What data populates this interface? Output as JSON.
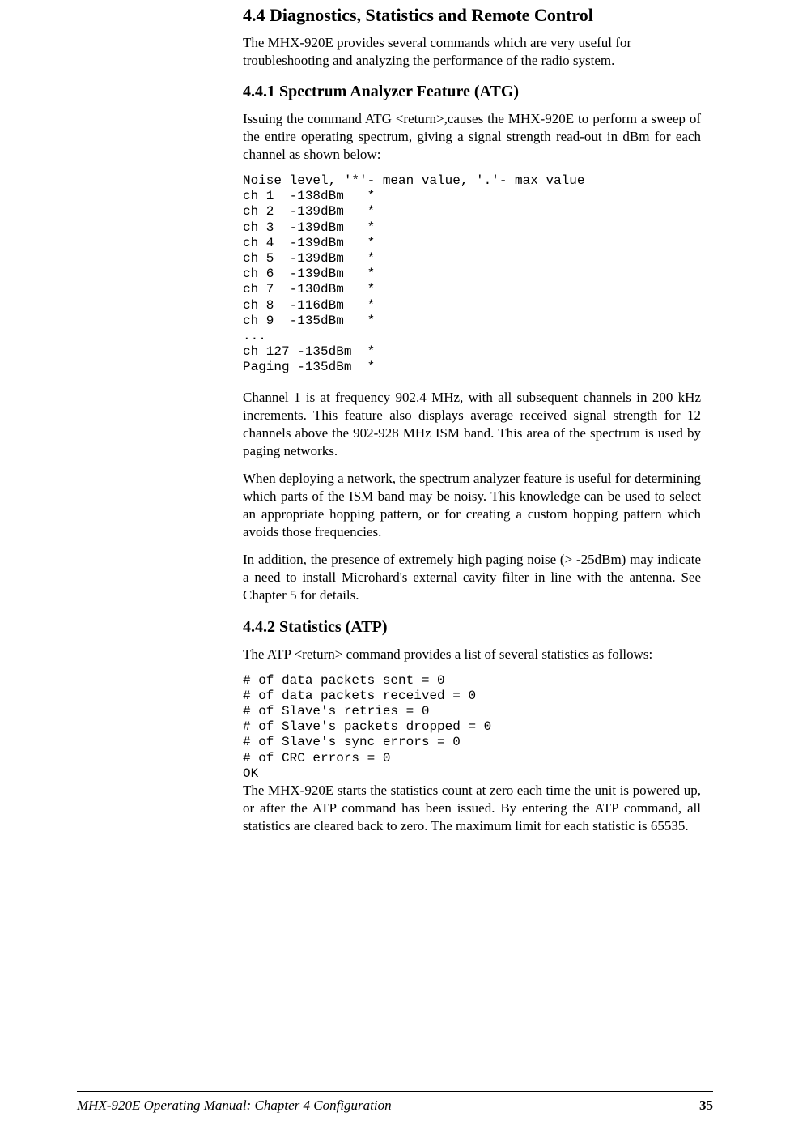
{
  "section": {
    "heading": "4.4 Diagnostics, Statistics and Remote Control",
    "intro": "The MHX-920E provides several commands which are very useful for troubleshooting and analyzing the performance of the radio system."
  },
  "subsection1": {
    "heading": "4.4.1  Spectrum Analyzer Feature (ATG)",
    "para1": "Issuing the command ATG <return>,causes the MHX-920E to perform a sweep of the entire operating spectrum, giving a signal strength read-out in dBm for each channel as shown below:",
    "mono": "Noise level, '*'- mean value, '.'- max value\nch 1  -138dBm   *\nch 2  -139dBm   *\nch 3  -139dBm   *\nch 4  -139dBm   *\nch 5  -139dBm   *\nch 6  -139dBm   *\nch 7  -130dBm   *\nch 8  -116dBm   *\nch 9  -135dBm   *\n...\nch 127 -135dBm  *\nPaging -135dBm  *",
    "para2": "Channel 1 is at frequency 902.4 MHz, with all subsequent channels in 200 kHz increments.  This feature also displays average received signal strength for  12 channels above the 902-928 MHz ISM band.  This area of the spectrum is used by paging networks.",
    "para3": "When deploying a network, the spectrum analyzer feature is useful for determining which parts of the ISM band may be noisy.  This knowledge can be used to select an appropriate hopping pattern, or for creating a custom hopping pattern which avoids those frequencies.",
    "para4": "In addition, the presence of extremely high paging noise (> -25dBm) may indicate a need to install Microhard's external cavity filter in line with the antenna.  See Chapter 5 for details."
  },
  "subsection2": {
    "heading": "4.4.2  Statistics (ATP)",
    "para1": "The ATP <return> command provides a list of several statistics as follows:",
    "mono": "# of data packets sent = 0\n# of data packets received = 0\n# of Slave's retries = 0\n# of Slave's packets dropped = 0\n# of Slave's sync errors = 0\n# of CRC errors = 0\nOK",
    "para2": "The MHX-920E starts the statistics count at zero each time the unit is powered up, or after the ATP command has been issued.  By entering the ATP command, all statistics are cleared back to zero.  The maximum limit for each statistic is 65535."
  },
  "footer": {
    "left": "MHX-920E Operating Manual: Chapter 4 Configuration",
    "page": "35"
  }
}
